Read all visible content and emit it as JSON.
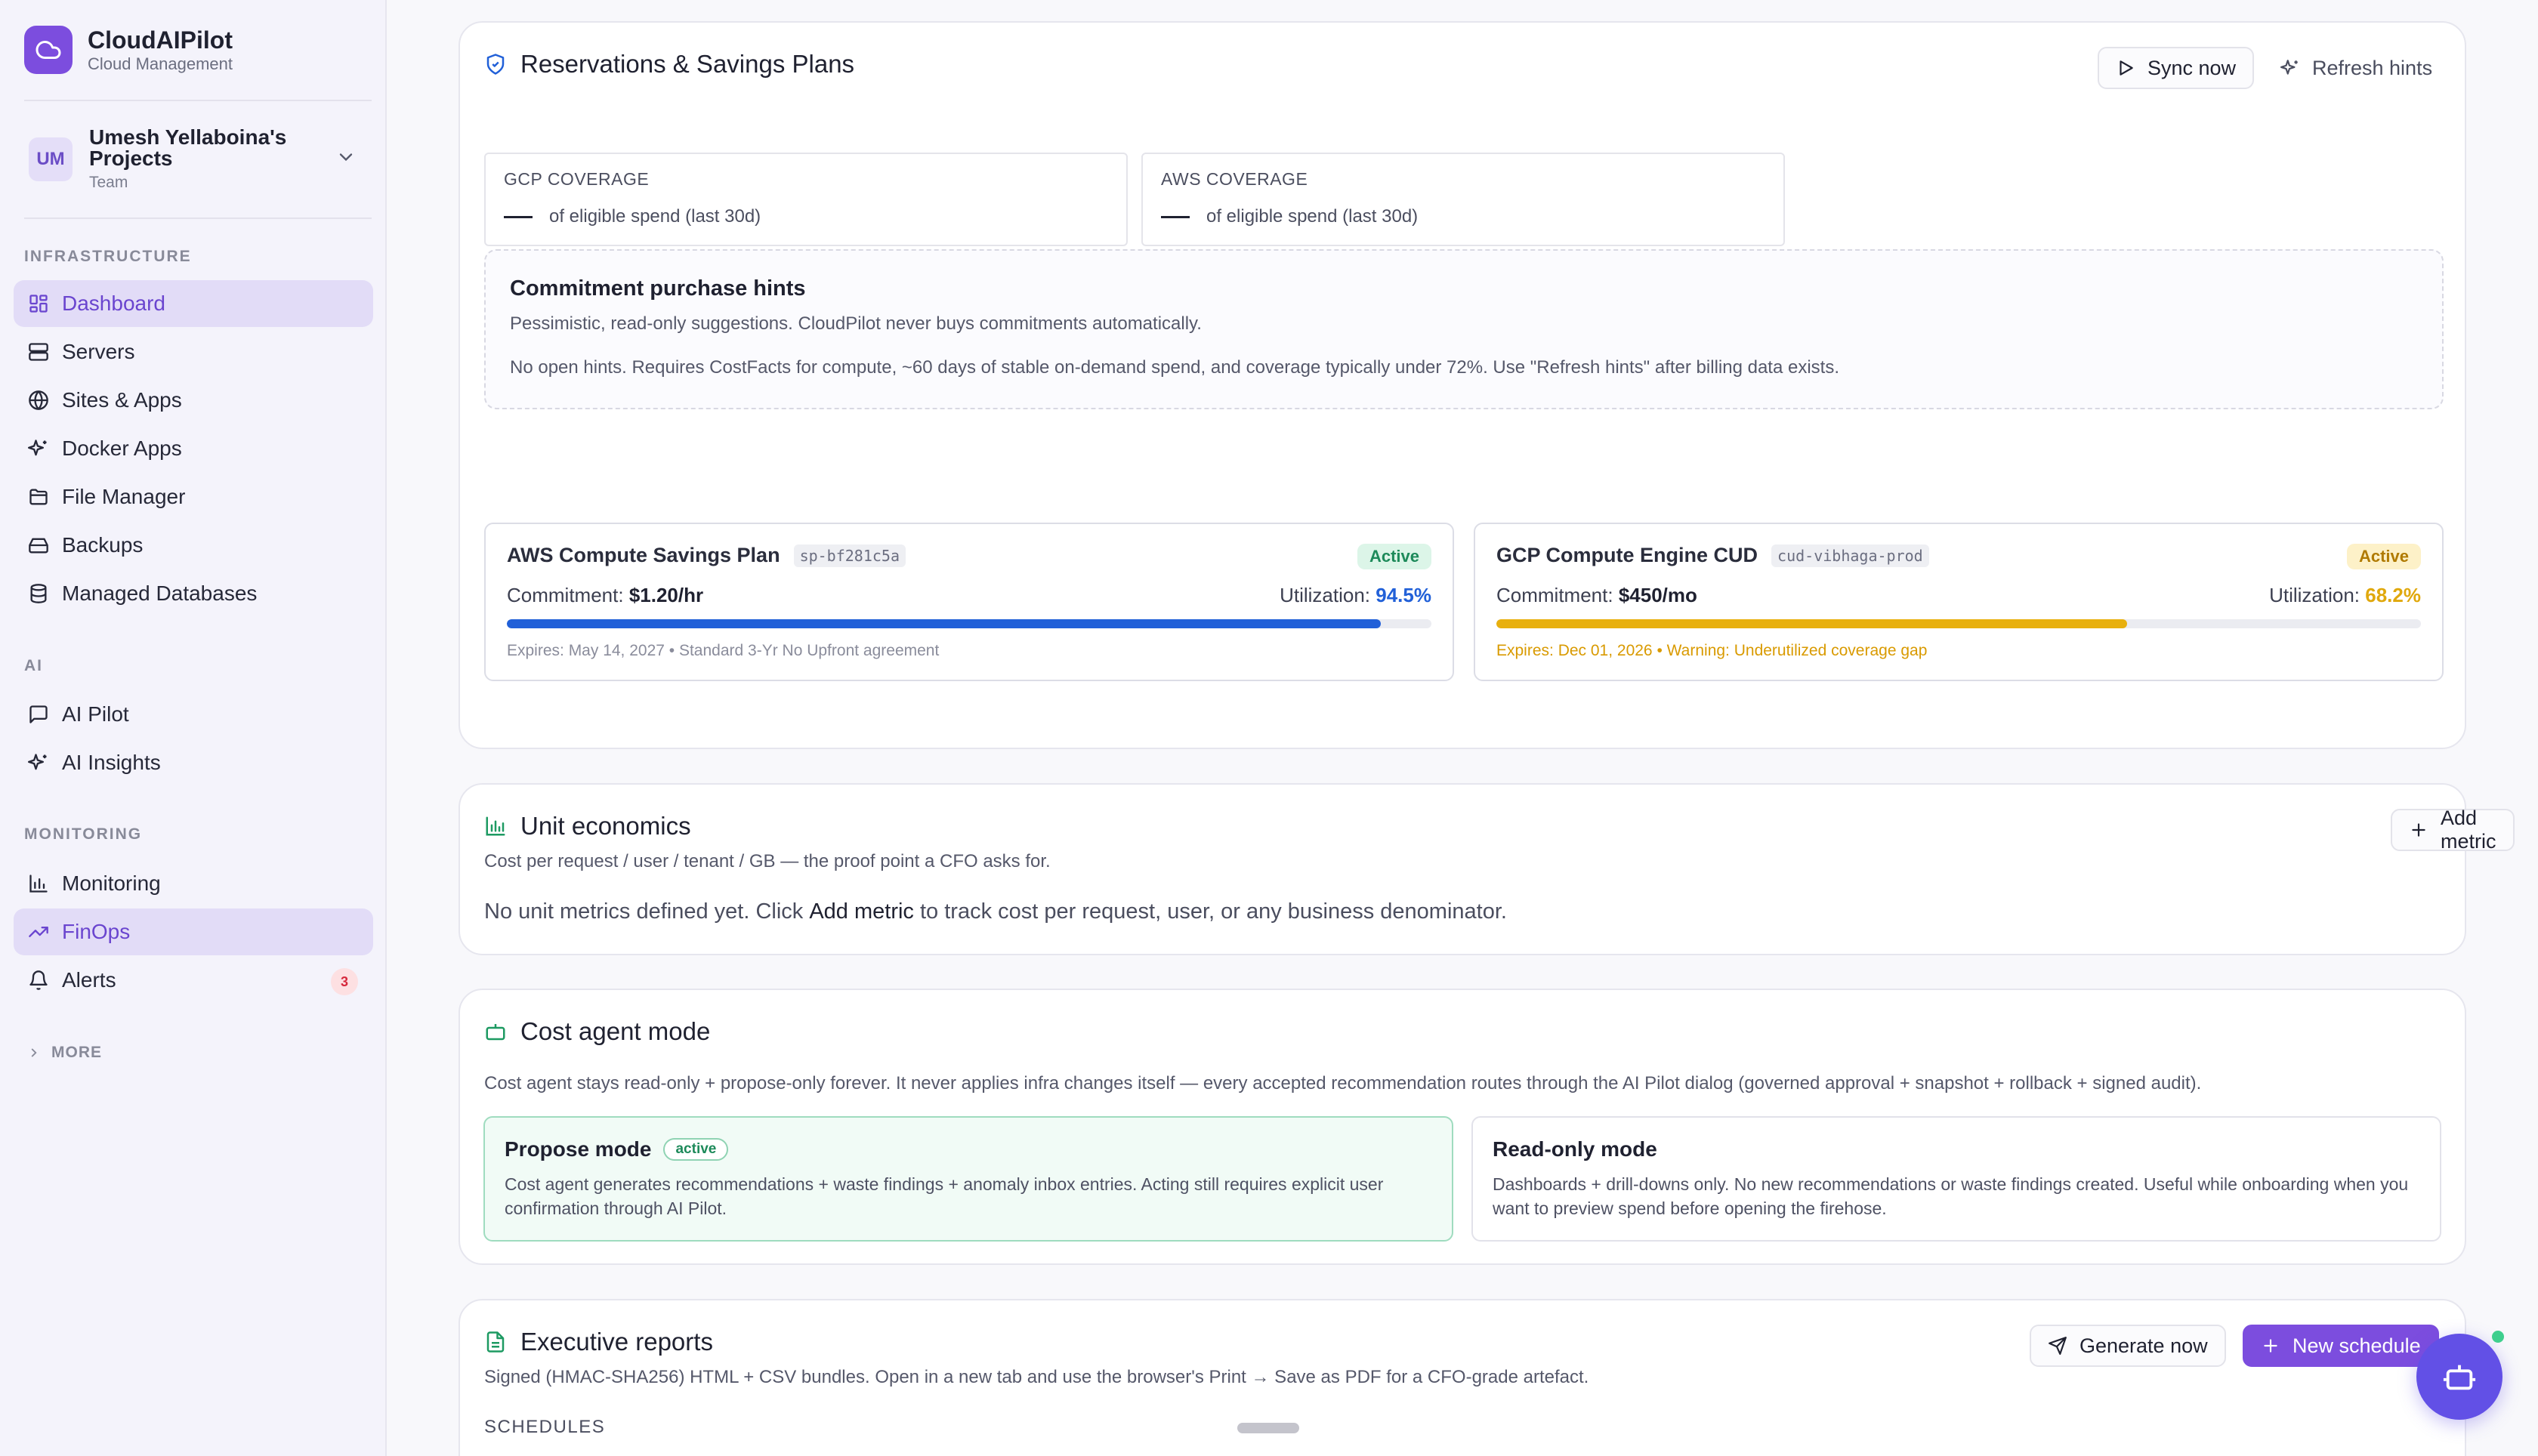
{
  "brand": {
    "name": "CloudAIPilot",
    "subtitle": "Cloud Management"
  },
  "project": {
    "initials": "UM",
    "name": "Umesh Yellaboina's Projects",
    "type": "Team"
  },
  "sidebar": {
    "sections": {
      "infrastructure": "INFRASTRUCTURE",
      "ai": "AI",
      "monitoring": "MONITORING"
    },
    "items": {
      "dashboard": "Dashboard",
      "servers": "Servers",
      "sites": "Sites & Apps",
      "docker": "Docker Apps",
      "files": "File Manager",
      "backups": "Backups",
      "databases": "Managed Databases",
      "ai_pilot": "AI Pilot",
      "ai_insights": "AI Insights",
      "monitoring": "Monitoring",
      "finops": "FinOps",
      "alerts": "Alerts"
    },
    "alerts_count": "3",
    "more": "MORE"
  },
  "reservations": {
    "title": "Reservations & Savings Plans",
    "sync_label": "Sync now",
    "refresh_label": "Refresh hints",
    "gcp_label": "GCP COVERAGE",
    "aws_label": "AWS COVERAGE",
    "coverage_caption": "of eligible spend (last 30d)",
    "hints_title": "Commitment purchase hints",
    "hints_sub": "Pessimistic, read-only suggestions. CloudPilot never buys commitments automatically.",
    "hints_none": "No open hints. Requires CostFacts for compute, ~60 days of stable on-demand spend, and coverage typically under 72%. Use \"Refresh hints\" after billing data exists.",
    "plans": [
      {
        "name": "AWS Compute Savings Plan",
        "code": "sp-bf281c5a",
        "status": "Active",
        "commitment_label": "Commitment:",
        "commitment": "$1.20/hr",
        "utilization_label": "Utilization:",
        "utilization": "94.5%",
        "utilization_value": 94.5,
        "footer": "Expires: May 14, 2027 • Standard 3-Yr No Upfront agreement",
        "color": "#2160d8"
      },
      {
        "name": "GCP Compute Engine CUD",
        "code": "cud-vibhaga-prod",
        "status": "Active",
        "commitment_label": "Commitment:",
        "commitment": "$450/mo",
        "utilization_label": "Utilization:",
        "utilization": "68.2%",
        "utilization_value": 68.2,
        "footer": "Expires: Dec 01, 2026 • Warning: Underutilized coverage gap",
        "color": "#e8b00e"
      }
    ]
  },
  "unit_economics": {
    "title": "Unit economics",
    "add_label": "Add metric",
    "subtitle": "Cost per request / user / tenant / GB — the proof point a CFO asks for.",
    "empty_pre": "No unit metrics defined yet. Click ",
    "empty_link": "Add metric",
    "empty_post": " to track cost per request, user, or any business denominator."
  },
  "cost_agent": {
    "title": "Cost agent mode",
    "subtitle": "Cost agent stays read-only + propose-only forever. It never applies infra changes itself — every accepted recommendation routes through the AI Pilot dialog (governed approval + snapshot + rollback + signed audit).",
    "propose_title": "Propose mode",
    "propose_badge": "active",
    "propose_desc": "Cost agent generates recommendations + waste findings + anomaly inbox entries. Acting still requires explicit user confirmation through AI Pilot.",
    "readonly_title": "Read-only mode",
    "readonly_desc": "Dashboards + drill-downs only. No new recommendations or waste findings created. Useful while onboarding when you want to preview spend before opening the firehose."
  },
  "reports": {
    "title": "Executive reports",
    "generate_label": "Generate now",
    "schedule_label": "New schedule",
    "subtitle": "Signed (HMAC-SHA256) HTML + CSV bundles. Open in a new tab and use the browser's Print → Save as PDF for a CFO-grade artefact.",
    "schedules_label": "SCHEDULES"
  },
  "colors": {
    "accent": "#7c4dde",
    "active_green": "#1d8a5a",
    "warning": "#e8b00e",
    "aws_blue": "#2160d8"
  }
}
